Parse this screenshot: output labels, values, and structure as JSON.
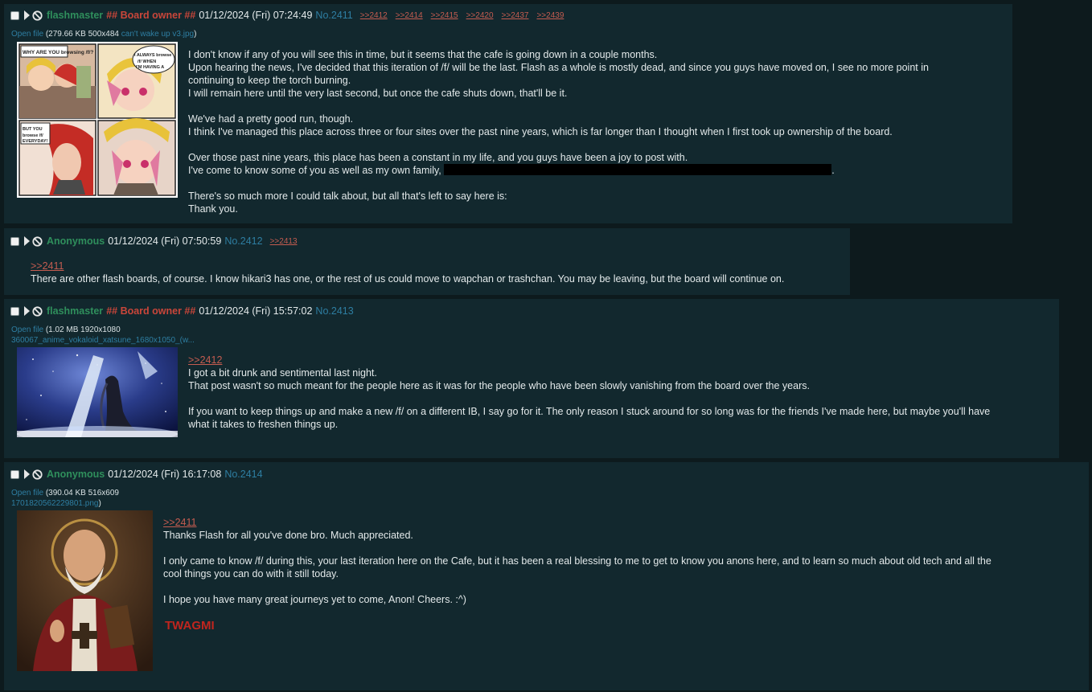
{
  "posts": [
    {
      "name": "flashmaster",
      "capcode": "## Board owner ##",
      "datetime": "01/12/2024 (Fri) 07:24:49",
      "number": "No.2411",
      "backlinks": [
        ">>2412",
        ">>2414",
        ">>2415",
        ">>2420",
        ">>2437",
        ">>2439"
      ],
      "file": {
        "open_label": "Open file",
        "meta": "(279.66 KB 500x484",
        "filename": "can't wake up v3.jpg",
        "close": ")",
        "comic_text": [
          "WHY ARE YOU browsing /f/?",
          "I ALWAYS browse /f/ WHEN I'M HAVING A BAD DAY.",
          "BUT YOU browse /f/ EVERYDAY!"
        ]
      },
      "lines": [
        "I don't know if any of you will see this in time, but it seems that the cafe is going down in a couple months.",
        "Upon hearing the news, I've decided that this iteration of /f/ will be the last. Flash as a whole is mostly dead, and since you guys have moved on, I see no more point in",
        "continuing to keep the torch burning.",
        "I will remain here until the very last second, but once the cafe shuts down, that'll be it.",
        "We've had a pretty good run, though.",
        "I think I've managed this place across three or four sites over the past nine years, which is far longer than I thought when I first took up ownership of the board.",
        "Over those past nine years, this place has been a constant in my life, and you guys have been a joy to post with.",
        "I've come to know some of you as well as my own family,",
        ".",
        "There's so much more I could talk about, but all that's left to say here is:",
        "Thank you."
      ]
    },
    {
      "name": "Anonymous",
      "datetime": "01/12/2024 (Fri) 07:50:59",
      "number": "No.2412",
      "backlinks": [
        ">>2413"
      ],
      "quote": ">>2411",
      "lines": [
        "There are other flash boards, of course. I know hikari3 has one, or the rest of us could move to wapchan or trashchan. You may be leaving, but the board will continue on."
      ]
    },
    {
      "name": "flashmaster",
      "capcode": "## Board owner ##",
      "datetime": "01/12/2024 (Fri) 15:57:02",
      "number": "No.2413",
      "file": {
        "open_label": "Open file",
        "meta": "(1.02 MB 1920x1080",
        "filename": "360067_anime_vokaloid_xatsune_1680x1050_(w..."
      },
      "quote": ">>2412",
      "lines": [
        "I got a bit drunk and sentimental last night.",
        "That post wasn't so much meant for the people here as it was for the people who have been slowly vanishing from the board over the years.",
        "If you want to keep things up and make a new /f/ on a different IB, I say go for it. The only reason I stuck around for so long was for the friends I've made here, but maybe you'll have",
        "what it takes to freshen things up."
      ]
    },
    {
      "name": "Anonymous",
      "datetime": "01/12/2024 (Fri) 16:17:08",
      "number": "No.2414",
      "file": {
        "open_label": "Open file",
        "meta": "(390.04 KB 516x609",
        "filename": "1701820562229801.png",
        "close": ")"
      },
      "quote": ">>2411",
      "lines": [
        "Thanks Flash for all you've done bro. Much appreciated.",
        "I only came to know /f/ during this, your last iteration here on the Cafe, but it has been a real blessing to me to get to know you anons here, and to learn so much about old tech and all the",
        "cool things you can do with it still today.",
        "I hope you have many great journeys yet to come, Anon! Cheers.  :^)"
      ],
      "red_text": "TWAGMI"
    }
  ],
  "colors": {
    "page_bg": "#0d1a1d",
    "post_bg": "#12282e",
    "name_green": "#2f8f5c",
    "capcode_red": "#c9463a",
    "link_blue": "#2e7ea2",
    "quote_red": "#c45c50"
  },
  "icons": [
    "checkbox-icon",
    "expand-arrow-icon",
    "hide-post-icon"
  ]
}
